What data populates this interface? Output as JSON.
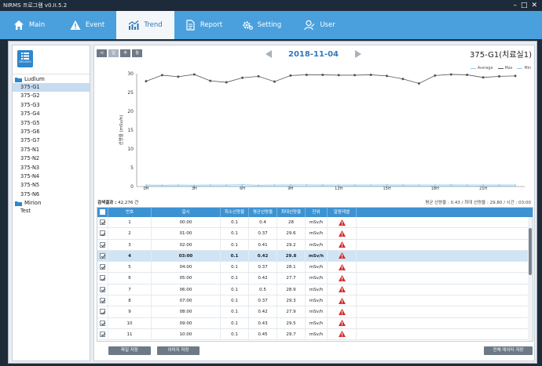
{
  "app": {
    "title": "NIRMS 프로그램 v0.II.5.2"
  },
  "nav": {
    "tabs": [
      {
        "label": "Main",
        "icon": "home-icon"
      },
      {
        "label": "Event",
        "icon": "warning-icon"
      },
      {
        "label": "Trend",
        "icon": "trend-chart-icon",
        "active": true
      },
      {
        "label": "Report",
        "icon": "document-icon"
      },
      {
        "label": "Setting",
        "icon": "gear-icon"
      },
      {
        "label": "User",
        "icon": "user-icon"
      }
    ]
  },
  "sidebar": {
    "devices_label": "DEVICES",
    "groups": [
      {
        "label": "Ludlum",
        "items": [
          "375-G1",
          "375-G2",
          "375-G3",
          "375-G4",
          "375-G5",
          "375-G6",
          "375-G7",
          "375-N1",
          "375-N2",
          "375-N3",
          "375-N4",
          "375-N5",
          "375-N6"
        ],
        "selected": "375-G1"
      },
      {
        "label": "Mirion",
        "items": [
          "Test"
        ]
      }
    ]
  },
  "periods": [
    "시",
    "일",
    "주",
    "월"
  ],
  "period_selected": "일",
  "date": "2018-11-04",
  "device_title": "375-G1(치료실1)",
  "legend": [
    {
      "label": "Average",
      "color": "#8fc6ea"
    },
    {
      "label": "Max",
      "color": "#555555"
    },
    {
      "label": "Min",
      "color": "#8fc6ea"
    }
  ],
  "chart_data": {
    "type": "line",
    "ylabel": "선량율 (mSv/h)",
    "ylim": [
      0,
      30
    ],
    "yticks": [
      0,
      5,
      10,
      15,
      20,
      25,
      30
    ],
    "xticks": [
      "0H",
      "3H",
      "6H",
      "9H",
      "12H",
      "15H",
      "18H",
      "21H"
    ],
    "x": [
      0,
      1,
      2,
      3,
      4,
      5,
      6,
      7,
      8,
      9,
      10,
      11,
      12,
      13,
      14,
      15,
      16,
      17,
      18,
      19,
      20,
      21,
      22,
      23
    ],
    "series": [
      {
        "name": "Max",
        "color": "#555555",
        "values": [
          28,
          29.6,
          29.2,
          29.8,
          28.1,
          27.7,
          28.9,
          29.3,
          27.9,
          29.5,
          29.7,
          29.7,
          29.6,
          29.6,
          29.7,
          29.4,
          28.6,
          27.4,
          29.5,
          29.8,
          29.7,
          29.0,
          29.3,
          29.4
        ]
      },
      {
        "name": "Average",
        "color": "#8fc6ea",
        "values": [
          0.4,
          0.37,
          0.41,
          0.37,
          0.42,
          0.42,
          0.5,
          0.37,
          0.42,
          0.43,
          0.45,
          0.4,
          0.42,
          0.4,
          0.41,
          0.43,
          0.4,
          0.42,
          0.41,
          0.43,
          0.42,
          0.41,
          0.4,
          0.42
        ]
      },
      {
        "name": "Min",
        "color": "#8fc6ea",
        "values": [
          0.1,
          0.1,
          0.1,
          0.1,
          0.1,
          0.1,
          0.1,
          0.1,
          0.1,
          0.1,
          0.1,
          0.1,
          0.1,
          0.1,
          0.1,
          0.1,
          0.1,
          0.1,
          0.1,
          0.1,
          0.1,
          0.1,
          0.1,
          0.1
        ]
      }
    ]
  },
  "summary": {
    "result_label": "검색결과 :",
    "result_value": "42,276 건",
    "stats": "평균 선량율 : 0.43  /  최대 선량율 : 29.80  /  시간 : 03:00"
  },
  "table": {
    "headers": [
      "번호",
      "일시",
      "최소선량율",
      "평균선량율",
      "최대선량율",
      "단위",
      "알람레벨"
    ],
    "rows": [
      {
        "no": "1",
        "time": "00:00",
        "min": "0.1",
        "avg": "0.4",
        "max": "28",
        "unit": "mSv/h",
        "alarm": true
      },
      {
        "no": "2",
        "time": "01:00",
        "min": "0.1",
        "avg": "0.37",
        "max": "29.6",
        "unit": "mSv/h",
        "alarm": true
      },
      {
        "no": "3",
        "time": "02:00",
        "min": "0.1",
        "avg": "0.41",
        "max": "29.2",
        "unit": "mSv/h",
        "alarm": true
      },
      {
        "no": "4",
        "time": "03:00",
        "min": "0.1",
        "avg": "0.42",
        "max": "29.8",
        "unit": "mSv/h",
        "alarm": true,
        "highlight": true
      },
      {
        "no": "5",
        "time": "04:00",
        "min": "0.1",
        "avg": "0.37",
        "max": "28.1",
        "unit": "mSv/h",
        "alarm": true
      },
      {
        "no": "6",
        "time": "05:00",
        "min": "0.1",
        "avg": "0.42",
        "max": "27.7",
        "unit": "mSv/h",
        "alarm": true
      },
      {
        "no": "7",
        "time": "06:00",
        "min": "0.1",
        "avg": "0.5",
        "max": "28.9",
        "unit": "mSv/h",
        "alarm": true
      },
      {
        "no": "8",
        "time": "07:00",
        "min": "0.1",
        "avg": "0.37",
        "max": "29.3",
        "unit": "mSv/h",
        "alarm": true
      },
      {
        "no": "9",
        "time": "08:00",
        "min": "0.1",
        "avg": "0.42",
        "max": "27.9",
        "unit": "mSv/h",
        "alarm": true
      },
      {
        "no": "10",
        "time": "09:00",
        "min": "0.1",
        "avg": "0.43",
        "max": "29.5",
        "unit": "mSv/h",
        "alarm": true
      },
      {
        "no": "11",
        "time": "10:00",
        "min": "0.1",
        "avg": "0.45",
        "max": "29.7",
        "unit": "mSv/h",
        "alarm": true
      }
    ]
  },
  "buttons": {
    "excel": "파일 저장",
    "image": "이미지 저장",
    "export_all": "전체 데이터 저장"
  },
  "colors": {
    "nav": "#4aa0dc",
    "accent": "#2d78bb",
    "alarm": "#d32f2f",
    "table_header": "#3d92d2"
  }
}
